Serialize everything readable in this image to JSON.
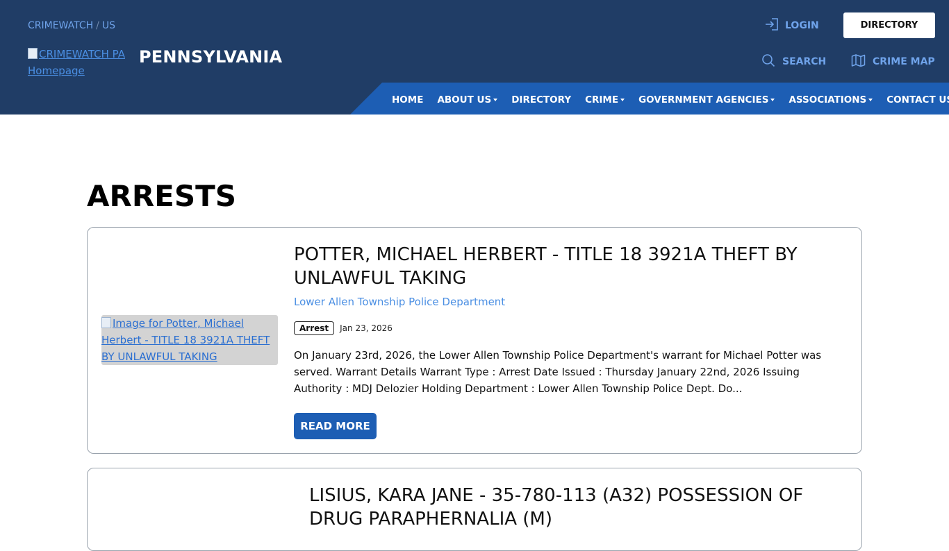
{
  "header": {
    "breadcrumb": [
      "CRIMEWATCH",
      "US"
    ],
    "logo_alt": "CRIMEWATCH PA Homepage",
    "state": "PENNSYLVANIA",
    "login_label": "LOGIN",
    "directory_label": "DIRECTORY",
    "search_label": "SEARCH",
    "crime_map_label": "CRIME MAP",
    "icons": {
      "login": "login-arrow-icon",
      "search": "search-icon",
      "map": "map-icon"
    }
  },
  "nav": {
    "items": [
      {
        "label": "HOME",
        "dropdown": false
      },
      {
        "label": "ABOUT US",
        "dropdown": true
      },
      {
        "label": "DIRECTORY",
        "dropdown": false
      },
      {
        "label": "CRIME",
        "dropdown": true
      },
      {
        "label": "GOVERNMENT AGENCIES",
        "dropdown": true
      },
      {
        "label": "ASSOCIATIONS",
        "dropdown": true
      },
      {
        "label": "CONTACT US",
        "dropdown": false
      }
    ]
  },
  "page": {
    "title": "ARRESTS"
  },
  "posts": [
    {
      "image_alt": "Image for Potter, Michael Herbert - TITLE 18 3921A THEFT BY UNLAWFUL TAKING",
      "title": "POTTER, MICHAEL HERBERT - TITLE 18 3921A THEFT BY UNLAWFUL TAKING",
      "agency": "Lower Allen Township Police Department",
      "tag": "Arrest",
      "date": "Jan 23, 2026",
      "excerpt": "On January 23rd, 2026, the Lower Allen Township Police Department's warrant for Michael Potter was served. Warrant Details Warrant Type : Arrest Date Issued : Thursday January 22nd, 2026 Issuing Authority : MDJ Delozier Holding Department : Lower Allen Township Police Dept. Do...",
      "read_more": "READ MORE"
    },
    {
      "title": "LISIUS, KARA JANE - 35-780-113 (A32) POSSESSION OF DRUG PARAPHERNALIA (M)"
    }
  ],
  "colors": {
    "header_bg": "#203d66",
    "nav_bg": "#1d5eb4",
    "link_blue": "#6fa3ea",
    "agency_blue": "#4b8fe3",
    "button_blue": "#1d5eb4"
  }
}
